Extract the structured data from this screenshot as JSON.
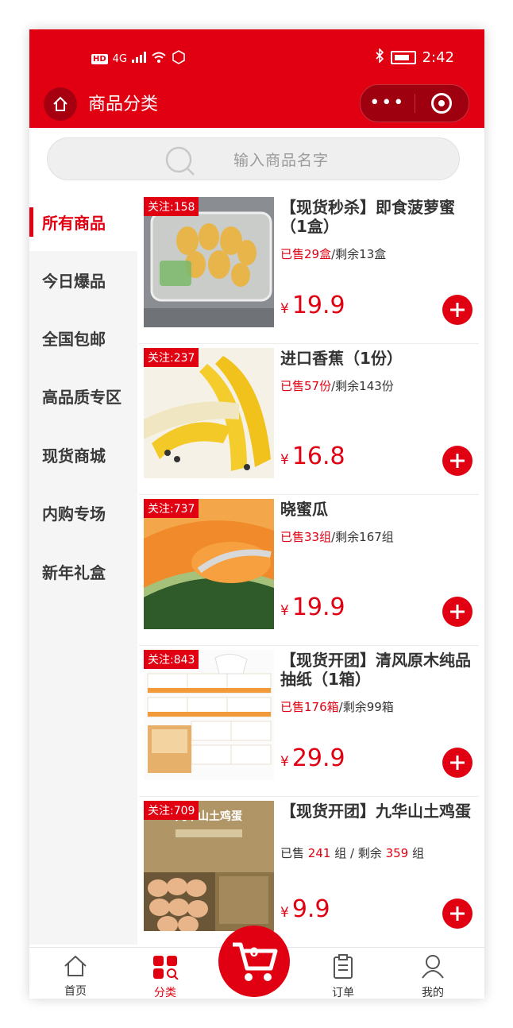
{
  "status_bar": {
    "hd": "HD",
    "network": "4G",
    "time": "2:42"
  },
  "header": {
    "title": "商品分类",
    "menu_dots": "•••"
  },
  "search": {
    "placeholder": "输入商品名字"
  },
  "categories": [
    {
      "label": "所有商品",
      "active": true
    },
    {
      "label": "今日爆品"
    },
    {
      "label": "全国包邮"
    },
    {
      "label": "高品质专区"
    },
    {
      "label": "现货商城"
    },
    {
      "label": "内购专场"
    },
    {
      "label": "新年礼盒"
    }
  ],
  "products": [
    {
      "tag": "关注:158",
      "title": "【现货秒杀】即食菠萝蜜（1盒）",
      "sold": "已售29盒",
      "remain": "/剩余13盒",
      "currency": "¥",
      "price": "19.9"
    },
    {
      "tag": "关注:237",
      "title": "进口香蕉（1份）",
      "sold": "已售57份",
      "remain": "/剩余143份",
      "currency": "¥",
      "price": "16.8"
    },
    {
      "tag": "关注:737",
      "title": "晓蜜瓜",
      "sold": "已售33组",
      "remain": "/剩余167组",
      "currency": "¥",
      "price": "19.9"
    },
    {
      "tag": "关注:843",
      "title": "【现货开团】清风原木纯品抽纸（1箱）",
      "sold": "已售176箱",
      "remain": "/剩余99箱",
      "currency": "¥",
      "price": "29.9"
    },
    {
      "tag": "关注:709",
      "title": "【现货开团】九华山土鸡蛋",
      "sold_prefix": "已售 ",
      "sold_num": "241",
      "sold_mid": " 组 / 剩余 ",
      "remain_num": "359",
      "sold_suffix": " 组",
      "currency": "¥",
      "price": "9.9",
      "img_caption": "九华山土鸡蛋"
    }
  ],
  "bottom_nav": [
    {
      "label": "首页"
    },
    {
      "label": "分类",
      "active": true
    },
    {
      "label": "订单"
    },
    {
      "label": "我的"
    }
  ],
  "cart": {
    "count": "0"
  },
  "colors": {
    "brand": "#e10012",
    "sidebar_bg": "#f5f5f5"
  }
}
